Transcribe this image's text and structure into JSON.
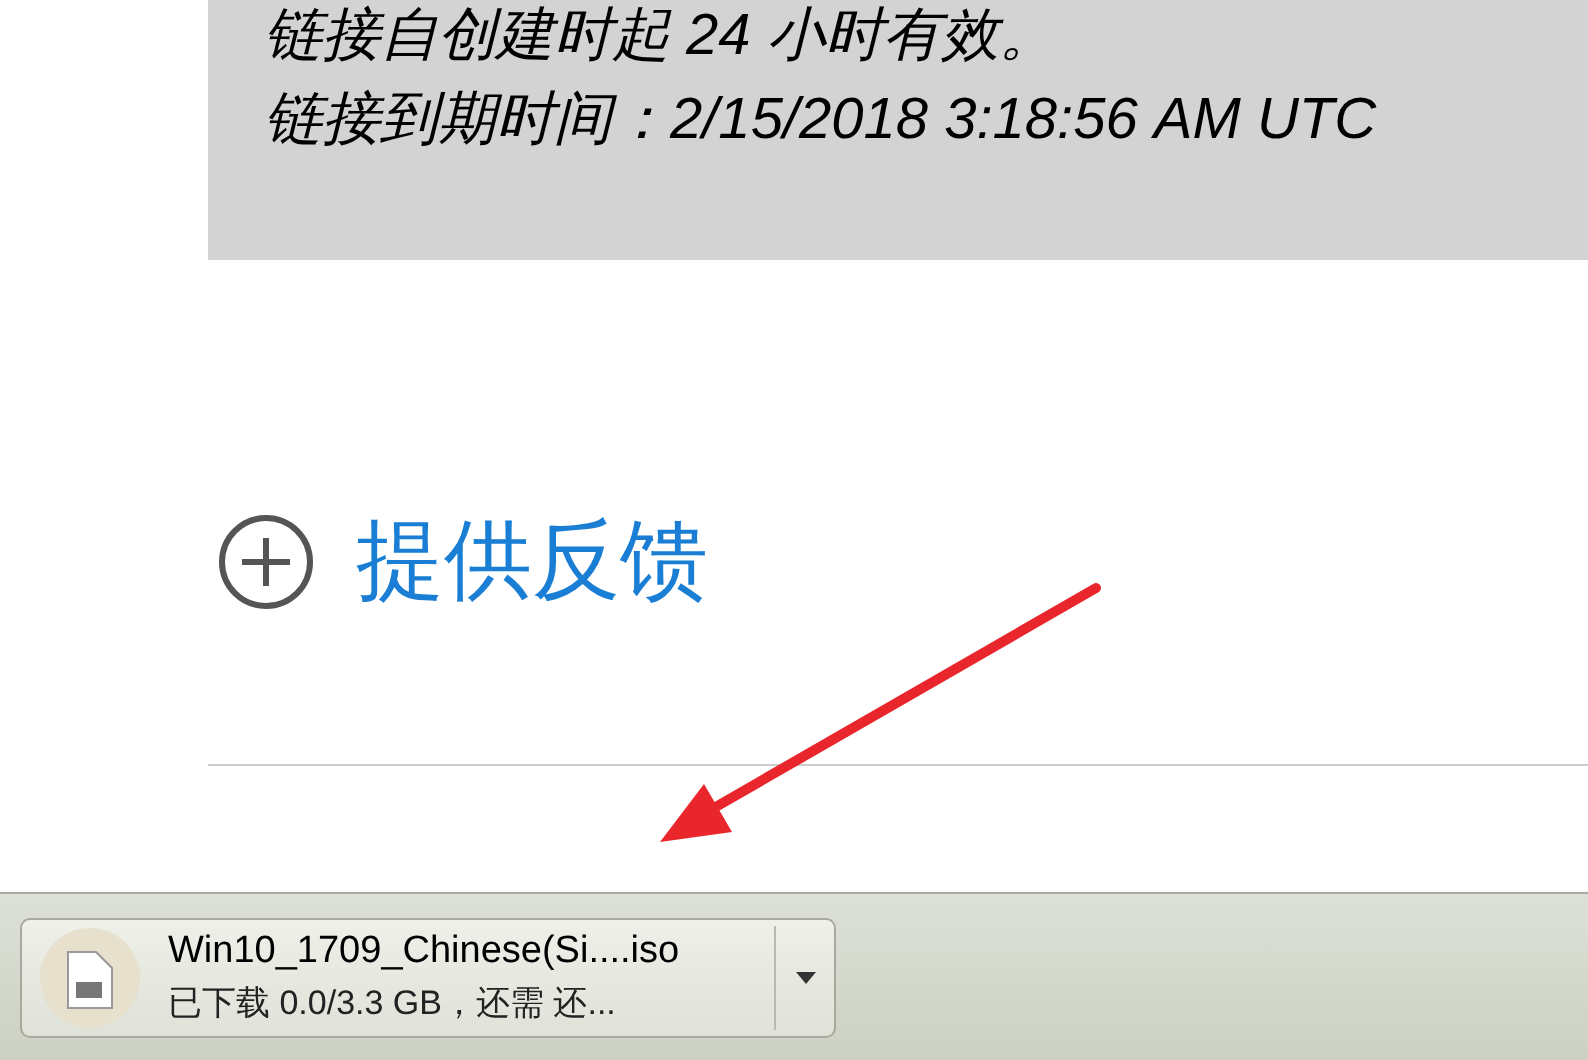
{
  "notice": {
    "lines": [
      "链接自创建时起 24 小时有效。",
      "链接到期时间：2/15/2018 3:18:56 AM UTC"
    ]
  },
  "feedback_link": {
    "label": "提供反馈"
  },
  "annotation": {
    "kind": "arrow"
  },
  "download_bar": {
    "items": [
      {
        "file_name": "Win10_1709_Chinese(Si....iso",
        "status": "已下载 0.0/3.3 GB，还需 还..."
      }
    ]
  }
}
